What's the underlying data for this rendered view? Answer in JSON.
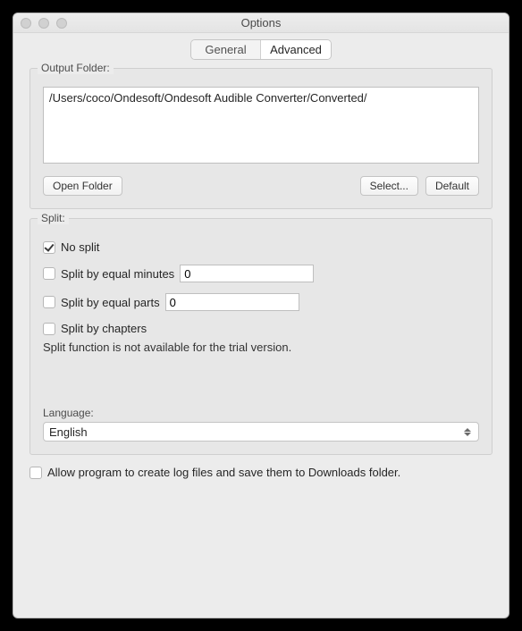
{
  "window": {
    "title": "Options"
  },
  "tabs": {
    "general": "General",
    "advanced": "Advanced"
  },
  "output": {
    "label": "Output Folder:",
    "path": "/Users/coco/Ondesoft/Ondesoft Audible Converter/Converted/",
    "open": "Open Folder",
    "select": "Select...",
    "default": "Default"
  },
  "split": {
    "label": "Split:",
    "no_split": "No split",
    "by_minutes": "Split by equal minutes",
    "minutes_value": "0",
    "by_parts": "Split by equal parts",
    "parts_value": "0",
    "by_chapters": "Split by chapters",
    "note": "Split function is not available for the trial version."
  },
  "language": {
    "label": "Language:",
    "value": "English"
  },
  "log": {
    "label": "Allow program to create log files and save them to Downloads folder."
  }
}
